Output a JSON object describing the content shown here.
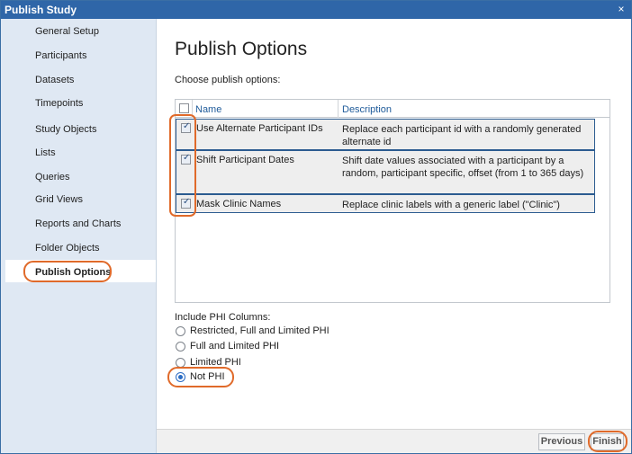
{
  "window": {
    "title": "Publish Study",
    "close_glyph": "×"
  },
  "sidebar": {
    "items": [
      {
        "label": "General Setup"
      },
      {
        "label": "Participants"
      },
      {
        "label": "Datasets"
      },
      {
        "label": "Timepoints"
      },
      {
        "label": "Study Objects"
      },
      {
        "label": "Lists"
      },
      {
        "label": "Queries"
      },
      {
        "label": "Grid Views"
      },
      {
        "label": "Reports and Charts"
      },
      {
        "label": "Folder Objects"
      },
      {
        "label": "Publish Options",
        "active": true
      }
    ]
  },
  "main": {
    "title": "Publish Options",
    "subtitle": "Choose publish options:",
    "grid": {
      "columns": [
        "Name",
        "Description"
      ],
      "rows": [
        {
          "checked": true,
          "name": "Use Alternate Participant IDs",
          "description": "Replace each participant id with a randomly generated alternate id"
        },
        {
          "checked": true,
          "name": "Shift Participant Dates",
          "description": "Shift date values associated with a participant by a random, participant specific, offset (from 1 to 365 days)"
        },
        {
          "checked": true,
          "name": "Mask Clinic Names",
          "description": "Replace clinic labels with a generic label (\"Clinic\")"
        }
      ]
    },
    "phi": {
      "title": "Include PHI Columns:",
      "options": [
        {
          "label": "Restricted, Full and Limited PHI",
          "selected": false
        },
        {
          "label": "Full and Limited PHI",
          "selected": false
        },
        {
          "label": "Limited PHI",
          "selected": false
        },
        {
          "label": "Not PHI",
          "selected": true
        }
      ]
    }
  },
  "footer": {
    "previous_label": "Previous",
    "finish_label": "Finish"
  },
  "colors": {
    "titlebar": "#2f66a8",
    "sidebar": "#dfe8f3",
    "highlight": "#e06a2a",
    "header_text": "#1f5b9a",
    "row_border": "#2b5b90"
  }
}
